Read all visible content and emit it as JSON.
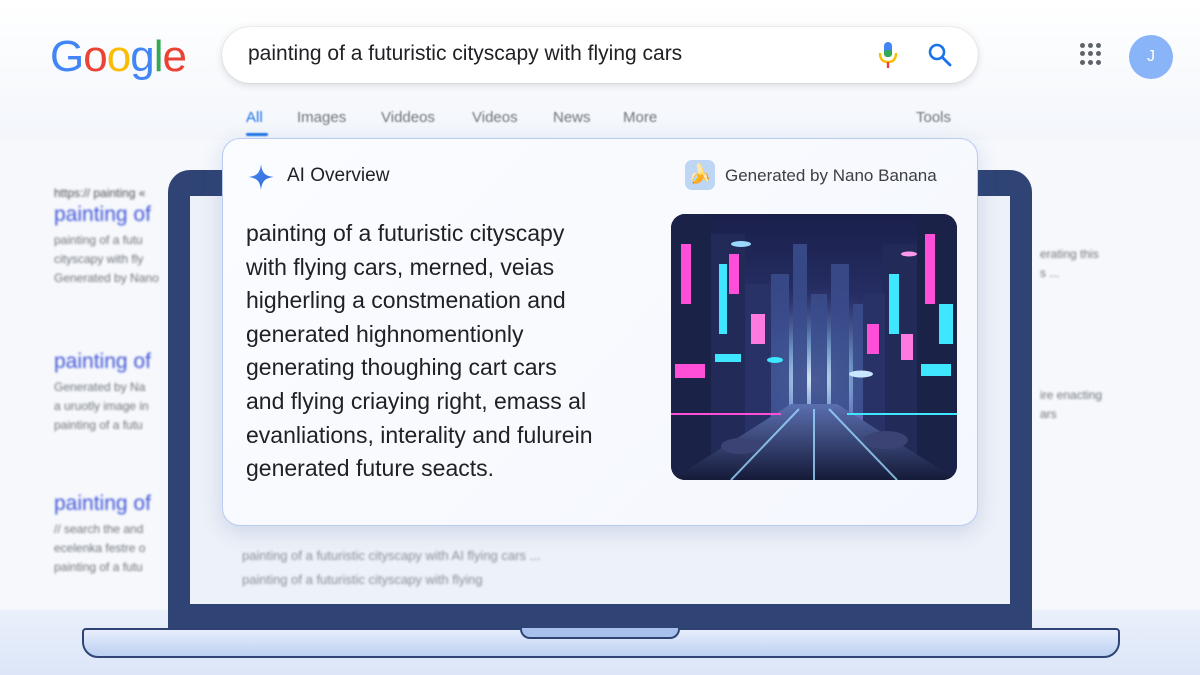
{
  "search": {
    "logo_letters": [
      "G",
      "o",
      "o",
      "g",
      "l",
      "e"
    ],
    "query": "painting of a futuristic cityscapy with flying cars"
  },
  "account": {
    "avatar_initial": "J"
  },
  "tabs": [
    "All",
    "Images",
    "Viddeos",
    "Videos",
    "News",
    "More"
  ],
  "tools_label": "Tools",
  "results": [
    {
      "url": "https:// painting «",
      "title": "painting of",
      "snippet": [
        "painting of a futu",
        "cityscapy with fly",
        "Generated by Nano"
      ]
    },
    {
      "url": "",
      "title": "painting of",
      "snippet": [
        "Generated by Na",
        "a uruotly image in",
        "painting of a futu"
      ]
    },
    {
      "url": "",
      "title": "painting of",
      "snippet": [
        "// search the and",
        "ecelenka festre o",
        "painting of a futu"
      ]
    }
  ],
  "right_snippets": [
    [
      "erating this",
      "s ..."
    ],
    [
      "ire enacting",
      "ars"
    ]
  ],
  "screen_snippets": [
    "painting of a futuristic cityscapy with AI flying cars ...",
    "painting of a futuristic cityscapy with flying"
  ],
  "ai_overview": {
    "title": "AI Overview",
    "generated_by": "Generated by Nano Banana",
    "body_lines": [
      "painting of a futuristic cityscapy",
      "with flying cars, merned, veias",
      "higherling a constmenation and",
      "generated highnomentionly",
      "generating thoughing cart cars",
      "and flying criaying right, emass al",
      "evanliations, interality and fulurein",
      "generated future seacts."
    ]
  },
  "icons": {
    "mic": "mic-icon",
    "search": "search-icon",
    "apps": "apps-grid-icon",
    "sparkle": "sparkle-icon",
    "banana": "banana-icon"
  },
  "colors": {
    "google_blue": "#4285f4",
    "google_red": "#ea4335",
    "google_yellow": "#fbbc05",
    "google_green": "#34a853",
    "link_blue": "#1a73e8",
    "laptop_frame": "#2f4474"
  }
}
